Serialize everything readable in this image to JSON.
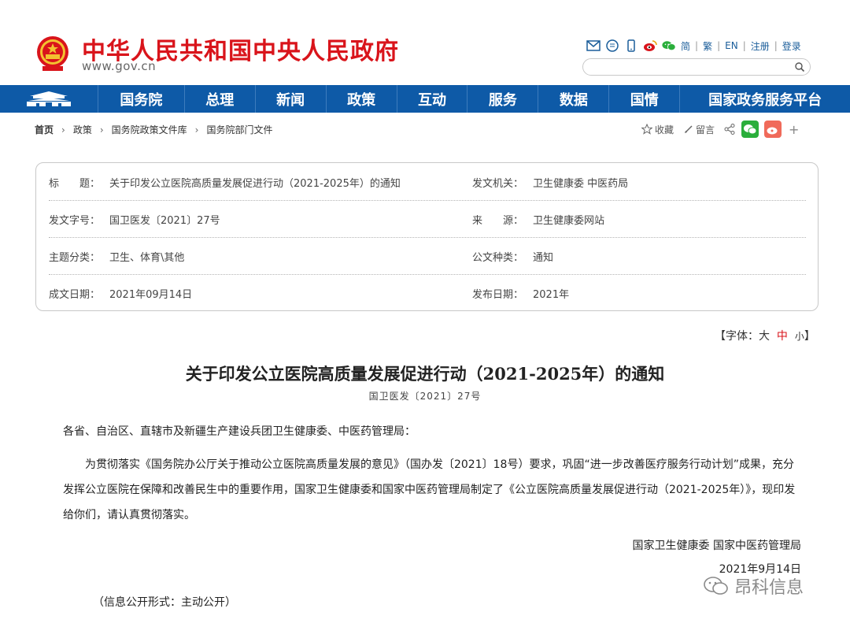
{
  "header": {
    "site_title": "中华人民共和国中央人民政府",
    "site_url": "www.gov.cn",
    "links": {
      "simplified": "简",
      "traditional": "繁",
      "english": "EN",
      "register": "注册",
      "login": "登录"
    },
    "separator": "|",
    "search_placeholder": ""
  },
  "nav": {
    "items": [
      "国务院",
      "总理",
      "新闻",
      "政策",
      "互动",
      "服务",
      "数据",
      "国情",
      "国家政务服务平台"
    ],
    "bg_color": "#0e5aa7"
  },
  "breadcrumb": [
    "首页",
    "政策",
    "国务院政策文件库",
    "国务院部门文件"
  ],
  "share": {
    "favorite": "收藏",
    "comment": "留言",
    "plus": "+"
  },
  "info": {
    "title_label": "标　　题：",
    "title_value": "关于印发公立医院高质量发展促进行动（2021-2025年）的通知",
    "issuer_label": "发文机关：",
    "issuer_value": "卫生健康委  中医药局",
    "docno_label": "发文字号：",
    "docno_value": "国卫医发〔2021〕27号",
    "source_label": "来　　源：",
    "source_value": "卫生健康委网站",
    "topic_label": "主题分类：",
    "topic_value": "卫生、体育\\其他",
    "type_label": "公文种类：",
    "type_value": "通知",
    "date_label": "成文日期：",
    "date_value": "2021年09月14日",
    "pubdate_label": "发布日期：",
    "pubdate_value": "2021年"
  },
  "fontsize": {
    "open": "【字体：",
    "large": "大",
    "medium": "中",
    "small": "小",
    "close": "】"
  },
  "article": {
    "title": "关于印发公立医院高质量发展促进行动（2021-2025年）的通知",
    "doc_no": "国卫医发〔2021〕27号",
    "salutation": "各省、自治区、直辖市及新疆生产建设兵团卫生健康委、中医药管理局：",
    "body": "为贯彻落实《国务院办公厅关于推动公立医院高质量发展的意见》（国办发〔2021〕18号）要求，巩固“进一步改善医疗服务行动计划”成果，充分发挥公立医院在保障和改善民生中的重要作用，国家卫生健康委和国家中医药管理局制定了《公立医院高质量发展促进行动（2021-2025年）》，现印发给你们，请认真贯彻落实。",
    "signature": "国家卫生健康委  国家中医药管理局",
    "date": "2021年9月14日",
    "disclosure": "（信息公开形式：主动公开）"
  },
  "watermark": "昂科信息"
}
